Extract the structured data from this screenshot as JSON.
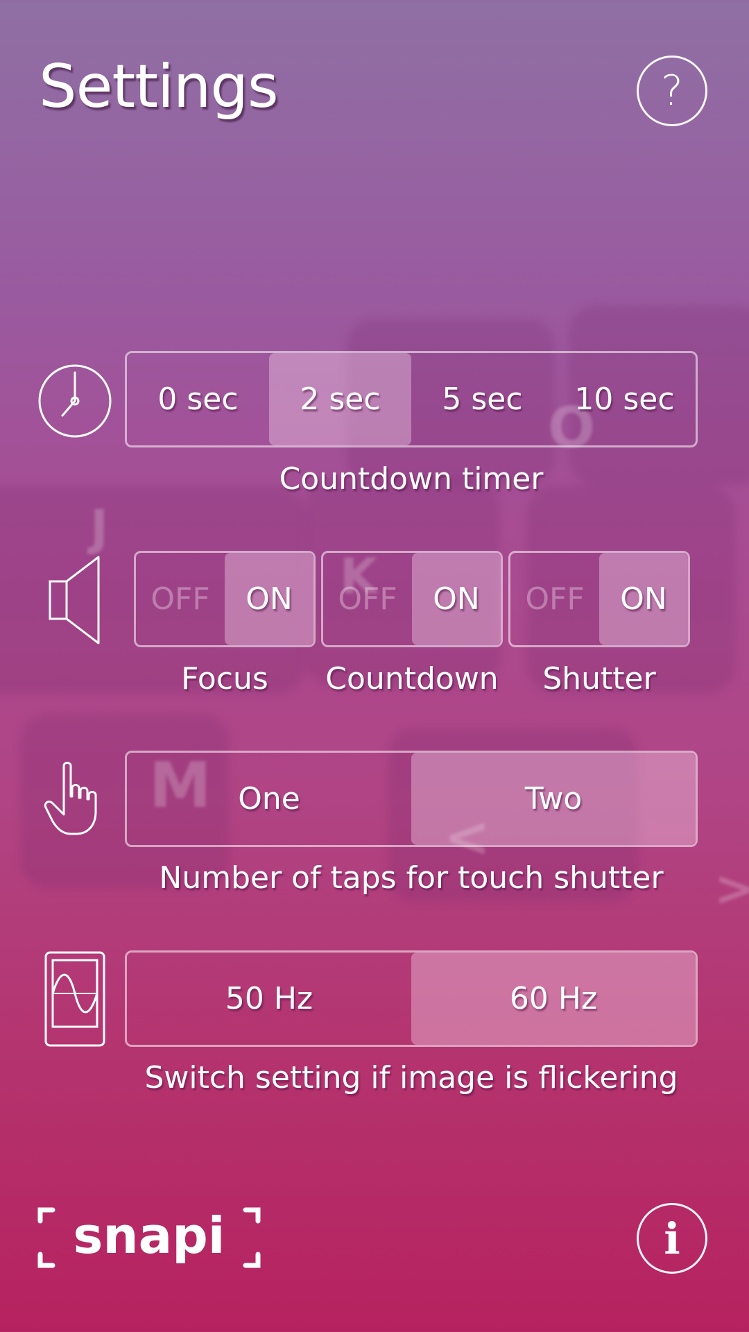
{
  "header": {
    "title": "Settings",
    "help_symbol": "?"
  },
  "countdown_timer": {
    "icon": "clock-icon",
    "options": [
      "0 sec",
      "2 sec",
      "5 sec",
      "10 sec"
    ],
    "selected": "2 sec",
    "caption": "Countdown timer"
  },
  "sounds": {
    "icon": "speaker-icon",
    "toggles": [
      {
        "name": "Focus",
        "off_label": "OFF",
        "on_label": "ON",
        "state": "ON"
      },
      {
        "name": "Countdown",
        "off_label": "OFF",
        "on_label": "ON",
        "state": "ON"
      },
      {
        "name": "Shutter",
        "off_label": "OFF",
        "on_label": "ON",
        "state": "ON"
      }
    ]
  },
  "taps": {
    "icon": "hand-pointer-icon",
    "options": [
      "One",
      "Two"
    ],
    "selected": "Two",
    "caption": "Number of taps for touch shutter"
  },
  "flicker": {
    "icon": "phone-wave-icon",
    "options": [
      "50 Hz",
      "60 Hz"
    ],
    "selected": "60 Hz",
    "caption": "Switch setting if image is flickering"
  },
  "footer": {
    "logo_text": "snapi",
    "info_symbol": "i"
  },
  "colors": {
    "background_top": "#8f70a4",
    "background_bottom": "#b6225f",
    "text": "#ffffff"
  }
}
